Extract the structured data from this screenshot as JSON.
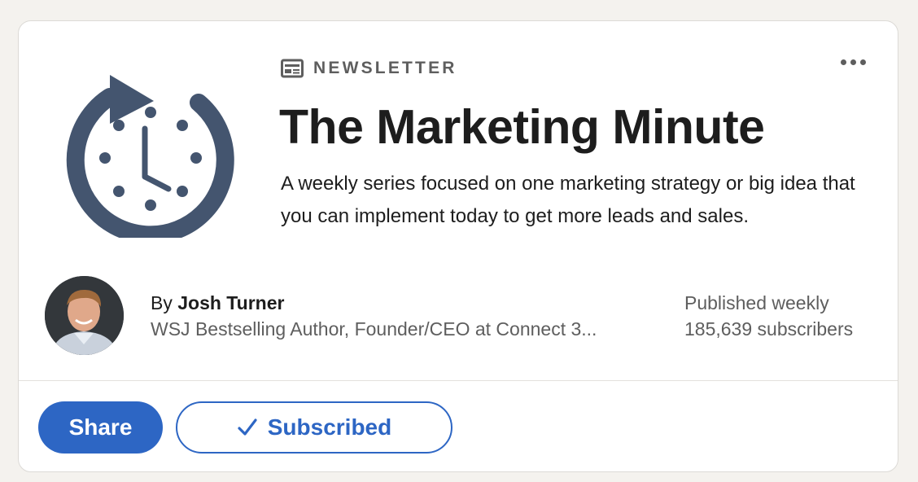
{
  "colors": {
    "accent": "#2d66c4",
    "logo": "#44556f",
    "text_primary": "#1d1d1d",
    "text_secondary": "#5e5e5e",
    "background": "#f4f2ee"
  },
  "header": {
    "eyebrow_icon": "newspaper-icon",
    "eyebrow": "NEWSLETTER",
    "more_icon": "more-dots-icon"
  },
  "newsletter": {
    "logo_icon": "clock-refresh-icon",
    "title": "The Marketing Minute",
    "description": "A weekly series focused on one marketing strategy or big idea that you can implement today to get more leads and sales."
  },
  "author": {
    "by": "By",
    "name": "Josh Turner",
    "headline": "WSJ Bestselling Author, Founder/CEO at Connect 3..."
  },
  "meta": {
    "frequency": "Published weekly",
    "subscribers": "185,639 subscribers"
  },
  "actions": {
    "share_label": "Share",
    "subscribed_label": "Subscribed",
    "subscribed_icon": "checkmark-icon"
  }
}
